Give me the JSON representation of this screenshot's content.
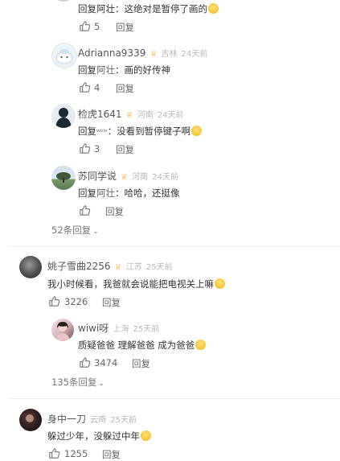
{
  "top_reply": {
    "text": "回复阿壮：这绝对是暂停了画的",
    "likes": "5",
    "reply_label": "回复"
  },
  "replies": [
    {
      "username": "Adrianna9339",
      "location": "吉林",
      "time": "24天前",
      "reply_prefix": "回复",
      "reply_to": "阿壮",
      "body": "：画的好传神",
      "likes": "4",
      "reply_label": "回复"
    },
    {
      "username": "检虎1641",
      "location": "河南",
      "time": "24天前",
      "reply_prefix": "回复",
      "reply_to": "ʷᵒˡᵒ",
      "body": "：没看到暂停键子啊",
      "likes": "3",
      "reply_label": "回复"
    },
    {
      "username": "苏同学说",
      "location": "河南",
      "time": "24天前",
      "reply_prefix": "回复",
      "reply_to": "阿壮",
      "body": "：哈哈，还挺像",
      "likes": "",
      "reply_label": "回复"
    }
  ],
  "more_replies_1": "52条回复",
  "comment_1": {
    "username": "姚子雪曲2256",
    "location": "江苏",
    "time": "25天前",
    "text": "我小时候看，我爸就会说能把电视关上嘛",
    "likes": "3226",
    "reply_label": "回复"
  },
  "sub_reply_1": {
    "username": "wiwi呀",
    "location": "上海",
    "time": "25天前",
    "text": "质疑爸爸 理解爸爸 成为爸爸",
    "likes": "3474",
    "reply_label": "回复"
  },
  "more_replies_2": "135条回复",
  "comment_2": {
    "username": "身中一刀",
    "location": "云南",
    "time": "25天前",
    "text": "躲过少年，没躲过中年",
    "likes": "1255",
    "reply_label": "回复"
  },
  "colors": {
    "vip_badge": "#f5a623",
    "meta_text": "#b8b8b8",
    "emoji": "#f8c434"
  }
}
